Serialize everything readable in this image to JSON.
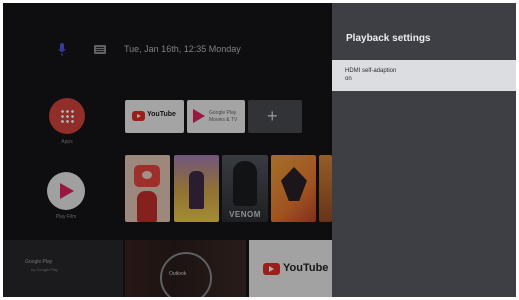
{
  "status_bar": {
    "clock": "Tue, Jan 16th, 12:35 Monday"
  },
  "home": {
    "apps_label": "Apps",
    "play_label": "Play Film",
    "rows": {
      "apps": [
        {
          "name": "YouTube",
          "label": "YouTube"
        },
        {
          "name": "Google Play",
          "label": "Google Play Movies & TV"
        },
        {
          "name": "Add",
          "label": "+"
        }
      ],
      "posters": [
        {
          "title": ""
        },
        {
          "title": ""
        },
        {
          "title": "VENOM"
        },
        {
          "title": ""
        },
        {
          "title": ""
        }
      ]
    },
    "bottom": {
      "left_title": "Google Play",
      "left_sub": "by Google Play",
      "mid_text": "Outlook",
      "yt_text": "YouTube"
    }
  },
  "panel": {
    "title": "Playback settings",
    "items": [
      {
        "label": "HDMI self-adaption",
        "value": "on"
      }
    ]
  },
  "colors": {
    "panel_bg": "#3d3f44",
    "selected_item_bg": "#dcdde0",
    "youtube_red": "#e52d27",
    "apps_red": "#d6453f"
  }
}
